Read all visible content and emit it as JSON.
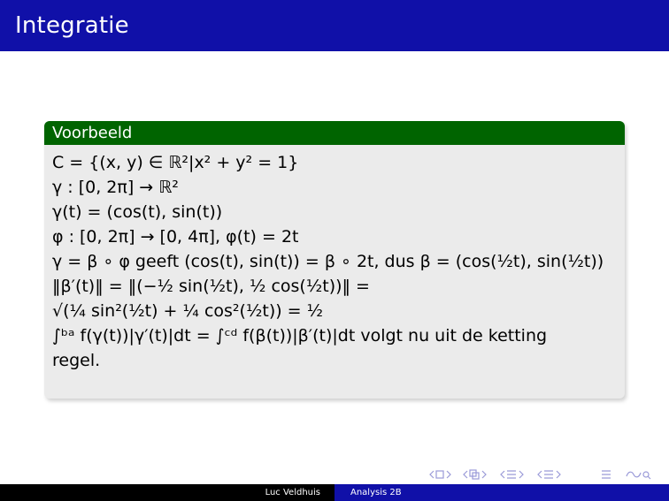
{
  "slide": {
    "title": "Integratie"
  },
  "block": {
    "heading": "Voorbeeld",
    "lines": [
      "C = {(x, y) ∈ ℝ²|x² + y² = 1}",
      "γ : [0, 2π] → ℝ²",
      "γ(t) = (cos(t), sin(t))",
      "φ : [0, 2π] → [0, 4π], φ(t) = 2t",
      "γ = β ∘ φ geeft (cos(t), sin(t)) = β ∘ 2t, dus β = (cos(½t), sin(½t))",
      "‖β′(t)‖ = ‖(−½ sin(½t), ½ cos(½t))‖ =",
      "√(¼ sin²(½t) + ¼ cos²(½t)) = ½",
      "∫ᵇᵃ f(γ(t))|γ′(t)|dt = ∫ᶜᵈ f(β(t))|β′(t)|dt volgt nu uit de ketting",
      "regel."
    ]
  },
  "footer": {
    "author": "Luc Veldhuis",
    "course": "Analysis 2B"
  }
}
